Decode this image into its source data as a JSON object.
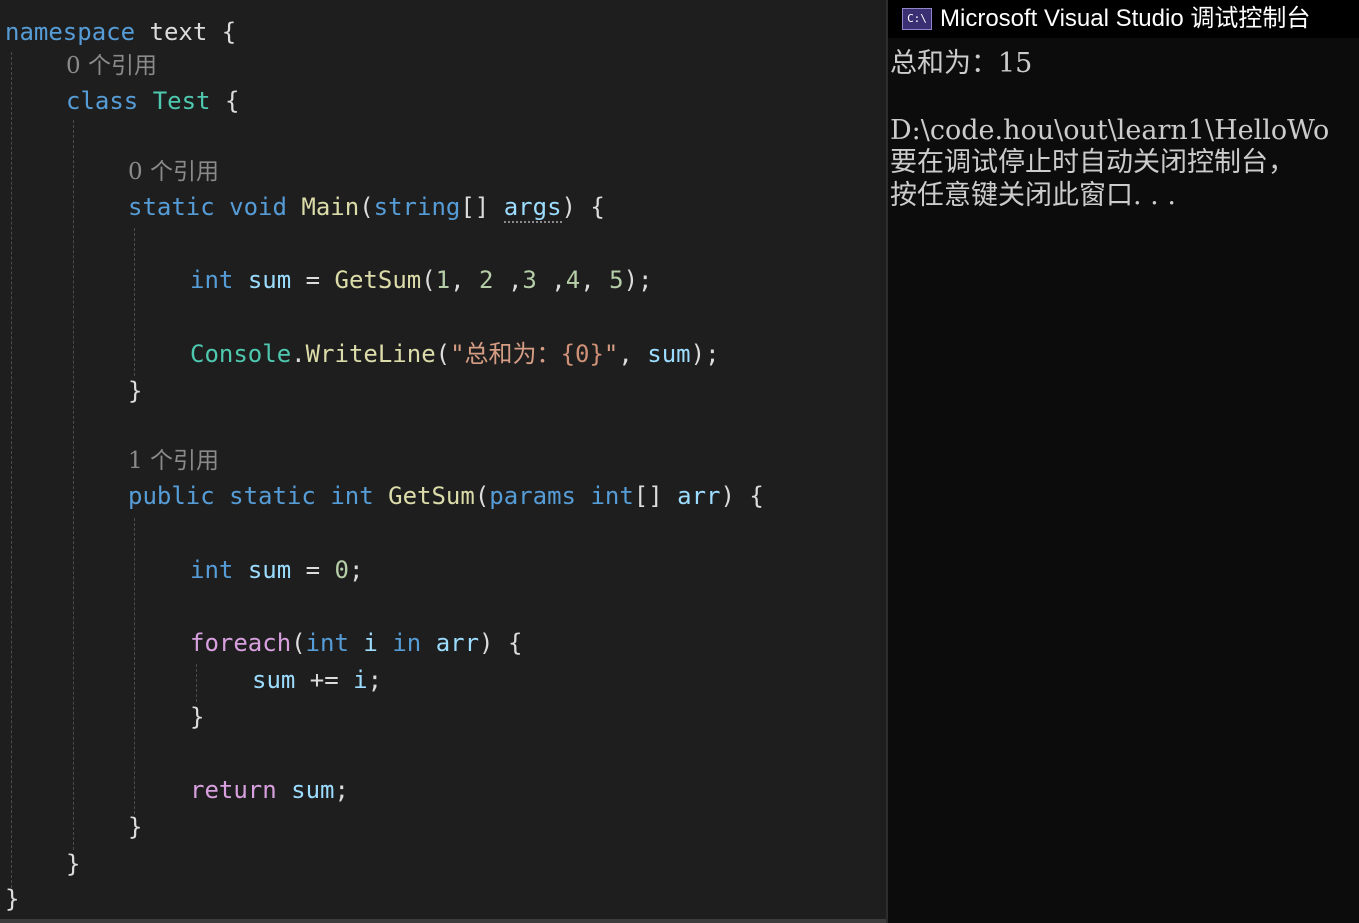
{
  "editor": {
    "lines": {
      "l1": [
        {
          "t": "namespace",
          "c": "kw"
        },
        {
          "t": " text ",
          "c": "pun"
        },
        {
          "t": "{",
          "c": "pun"
        }
      ],
      "l2": [
        {
          "t": "class",
          "c": "kw"
        },
        {
          "t": " ",
          "c": "pun"
        },
        {
          "t": "Test",
          "c": "type"
        },
        {
          "t": " {",
          "c": "pun"
        }
      ],
      "l3": [
        {
          "t": "static",
          "c": "kw"
        },
        {
          "t": " ",
          "c": "pun"
        },
        {
          "t": "void",
          "c": "kw"
        },
        {
          "t": " ",
          "c": "pun"
        },
        {
          "t": "Main",
          "c": "fn"
        },
        {
          "t": "(",
          "c": "pun"
        },
        {
          "t": "string",
          "c": "kw"
        },
        {
          "t": "[] ",
          "c": "pun"
        },
        {
          "t": "args",
          "c": "var unused"
        },
        {
          "t": ") {",
          "c": "pun"
        }
      ],
      "l4": [
        {
          "t": "int",
          "c": "kw"
        },
        {
          "t": " ",
          "c": "pun"
        },
        {
          "t": "sum",
          "c": "var"
        },
        {
          "t": " = ",
          "c": "pun"
        },
        {
          "t": "GetSum",
          "c": "fn"
        },
        {
          "t": "(",
          "c": "pun"
        },
        {
          "t": "1",
          "c": "num"
        },
        {
          "t": ", ",
          "c": "pun"
        },
        {
          "t": "2",
          "c": "num"
        },
        {
          "t": " ,",
          "c": "pun"
        },
        {
          "t": "3",
          "c": "num"
        },
        {
          "t": " ,",
          "c": "pun"
        },
        {
          "t": "4",
          "c": "num"
        },
        {
          "t": ", ",
          "c": "pun"
        },
        {
          "t": "5",
          "c": "num"
        },
        {
          "t": ");",
          "c": "pun"
        }
      ],
      "l5": [
        {
          "t": "Console",
          "c": "type"
        },
        {
          "t": ".",
          "c": "pun"
        },
        {
          "t": "WriteLine",
          "c": "fn"
        },
        {
          "t": "(",
          "c": "pun"
        },
        {
          "t": "\"总和为：",
          "c": "str"
        },
        {
          "t": "{0}",
          "c": "fmt"
        },
        {
          "t": "\"",
          "c": "str"
        },
        {
          "t": ", ",
          "c": "pun"
        },
        {
          "t": "sum",
          "c": "var"
        },
        {
          "t": ");",
          "c": "pun"
        }
      ],
      "l6": [
        {
          "t": "}",
          "c": "pun"
        }
      ],
      "l7": [
        {
          "t": "public",
          "c": "kw"
        },
        {
          "t": " ",
          "c": "pun"
        },
        {
          "t": "static",
          "c": "kw"
        },
        {
          "t": " ",
          "c": "pun"
        },
        {
          "t": "int",
          "c": "kw"
        },
        {
          "t": " ",
          "c": "pun"
        },
        {
          "t": "GetSum",
          "c": "fn"
        },
        {
          "t": "(",
          "c": "pun"
        },
        {
          "t": "params",
          "c": "kw"
        },
        {
          "t": " ",
          "c": "pun"
        },
        {
          "t": "int",
          "c": "kw"
        },
        {
          "t": "[] ",
          "c": "pun"
        },
        {
          "t": "arr",
          "c": "var"
        },
        {
          "t": ") {",
          "c": "pun"
        }
      ],
      "l8": [
        {
          "t": "int",
          "c": "kw"
        },
        {
          "t": " ",
          "c": "pun"
        },
        {
          "t": "sum",
          "c": "var"
        },
        {
          "t": " = ",
          "c": "pun"
        },
        {
          "t": "0",
          "c": "num"
        },
        {
          "t": ";",
          "c": "pun"
        }
      ],
      "l9": [
        {
          "t": "foreach",
          "c": "ctl"
        },
        {
          "t": "(",
          "c": "pun"
        },
        {
          "t": "int",
          "c": "kw"
        },
        {
          "t": " ",
          "c": "pun"
        },
        {
          "t": "i",
          "c": "var"
        },
        {
          "t": " ",
          "c": "pun"
        },
        {
          "t": "in",
          "c": "kw"
        },
        {
          "t": " ",
          "c": "pun"
        },
        {
          "t": "arr",
          "c": "var"
        },
        {
          "t": ") {",
          "c": "pun"
        }
      ],
      "l10": [
        {
          "t": "sum",
          "c": "var"
        },
        {
          "t": " += ",
          "c": "pun"
        },
        {
          "t": "i",
          "c": "var"
        },
        {
          "t": ";",
          "c": "pun"
        }
      ],
      "l11": [
        {
          "t": "}",
          "c": "pun"
        }
      ],
      "l12": [
        {
          "t": "return",
          "c": "ctl"
        },
        {
          "t": " ",
          "c": "pun"
        },
        {
          "t": "sum",
          "c": "var"
        },
        {
          "t": ";",
          "c": "pun"
        }
      ],
      "l13": [
        {
          "t": "}",
          "c": "pun"
        }
      ],
      "l14": [
        {
          "t": "}",
          "c": "pun"
        }
      ],
      "l15": [
        {
          "t": "}",
          "c": "pun"
        }
      ]
    },
    "codelens": {
      "test_class": "0 个引用",
      "main_method": "0 个引用",
      "getsum_method": "1 个引用"
    }
  },
  "console": {
    "title": "Microsoft Visual Studio 调试控制台",
    "icon_text": "C:\\",
    "lines": {
      "output": "总和为：15",
      "path": "D:\\code.hou\\out\\learn1\\HelloWo",
      "notice": "要在调试停止时自动关闭控制台，",
      "prompt": "按任意键关闭此窗口. . ."
    }
  },
  "colors": {
    "editor_background": "#1e1e1e",
    "keyword": "#569cd6",
    "control_keyword": "#d8a0df",
    "type": "#4ec9b0",
    "method": "#dcdcaa",
    "variable": "#9cdcfe",
    "number": "#b5cea8",
    "string": "#d69d85",
    "console_background": "#0c0c0c",
    "console_text": "#cccccc"
  }
}
